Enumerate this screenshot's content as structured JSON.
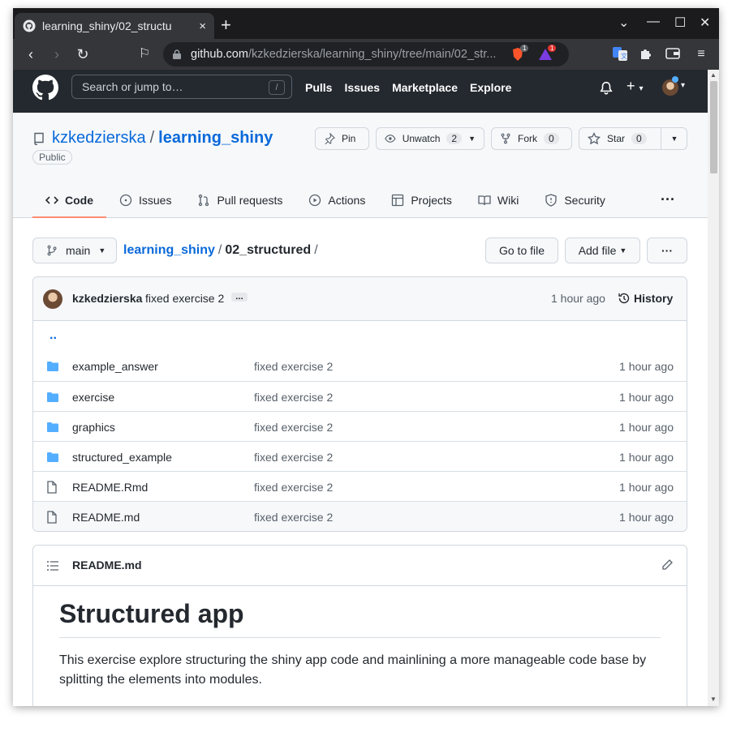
{
  "browser": {
    "tab_title": "learning_shiny/02_structu",
    "tab_close": "×",
    "new_tab": "+",
    "url_host": "github.com",
    "url_path": "/kzkedzierska/learning_shiny/tree/main/02_str...",
    "brave_badge": "1",
    "alert_badge": "1"
  },
  "gh_header": {
    "search_placeholder": "Search or jump to…",
    "search_key": "/",
    "nav": [
      "Pulls",
      "Issues",
      "Marketplace",
      "Explore"
    ]
  },
  "repo": {
    "owner": "kzkedzierska",
    "separator": "/",
    "name": "learning_shiny",
    "visibility": "Public",
    "pin_label": "Pin",
    "unwatch_label": "Unwatch",
    "watch_count": "2",
    "fork_label": "Fork",
    "fork_count": "0",
    "star_label": "Star",
    "star_count": "0",
    "tabs": [
      {
        "label": "Code",
        "active": true
      },
      {
        "label": "Issues"
      },
      {
        "label": "Pull requests"
      },
      {
        "label": "Actions"
      },
      {
        "label": "Projects"
      },
      {
        "label": "Wiki"
      },
      {
        "label": "Security"
      }
    ],
    "more": "···"
  },
  "file_nav": {
    "branch": "main",
    "crumb_root": "learning_shiny",
    "crumb_sep": "/",
    "crumb_current": "02_structured",
    "crumb_trail": "/",
    "go_to_file": "Go to file",
    "add_file": "Add file",
    "more": "···"
  },
  "commit": {
    "author": "kzkedzierska",
    "message": "fixed exercise 2",
    "ellipsis": "…",
    "time": "1 hour ago",
    "history": "History"
  },
  "files": {
    "updir": "..",
    "rows": [
      {
        "name": "example_answer",
        "type": "folder",
        "message": "fixed exercise 2",
        "time": "1 hour ago"
      },
      {
        "name": "exercise",
        "type": "folder",
        "message": "fixed exercise 2",
        "time": "1 hour ago"
      },
      {
        "name": "graphics",
        "type": "folder",
        "message": "fixed exercise 2",
        "time": "1 hour ago"
      },
      {
        "name": "structured_example",
        "type": "folder",
        "message": "fixed exercise 2",
        "time": "1 hour ago"
      },
      {
        "name": "README.Rmd",
        "type": "file",
        "message": "fixed exercise 2",
        "time": "1 hour ago"
      },
      {
        "name": "README.md",
        "type": "file",
        "message": "fixed exercise 2",
        "time": "1 hour ago"
      }
    ]
  },
  "readme": {
    "filename": "README.md",
    "heading": "Structured app",
    "body": "This exercise explore structuring the shiny app code and mainlining a more manageable code base by splitting the elements into modules."
  },
  "colors": {
    "link": "#0969da",
    "header_bg": "#24292f",
    "folder": "#54aeff",
    "active_tab_underline": "#fd8c73"
  }
}
